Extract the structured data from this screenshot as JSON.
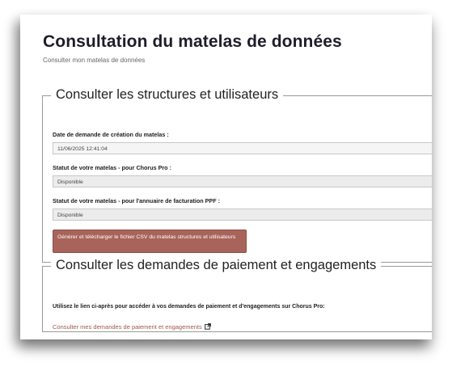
{
  "page": {
    "title": "Consultation du matelas de données",
    "subtitle": "Consulter mon matelas de données"
  },
  "section_structures": {
    "legend": "Consulter les structures et utilisateurs",
    "fields": [
      {
        "label": "Date de demande de création du matelas :",
        "value": "11/06/2025 12:41:04"
      },
      {
        "label": "Statut de votre matelas - pour Chorus Pro :",
        "value": "Disponible"
      },
      {
        "label": "Statut de votre matelas - pour l'annuaire de facturation PPF :",
        "value": "Disponible"
      }
    ],
    "button_label": "Générer et télécharger le fichier CSV du matelas structures et utilisateurs"
  },
  "section_paiement": {
    "legend": "Consulter les demandes de paiement et engagements",
    "description": "Utilisez le lien ci-après pour accéder à vos demandes de paiement et d'engagements sur Chorus Pro:",
    "link_label": "Consulter mes demandes de paiement et engagements",
    "link_icon": "external-link-icon"
  },
  "colors": {
    "button_bg": "#a8645a",
    "link": "#a0574d",
    "title": "#1e1e2a"
  }
}
